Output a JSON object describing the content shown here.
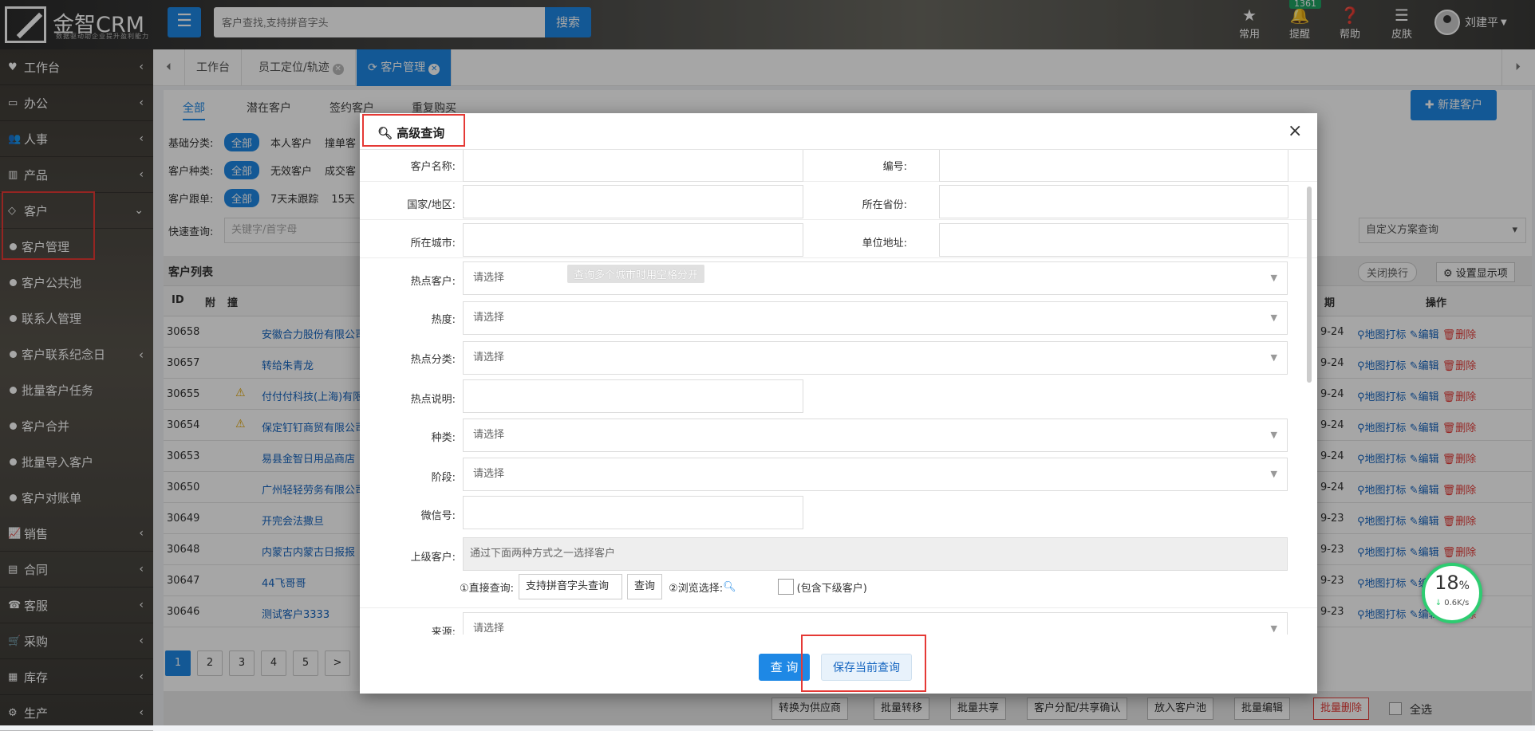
{
  "header": {
    "app_name": "金智CRM",
    "slogan": "数据驱动助企业提升盈利能力",
    "search_placeholder": "客户查找,支持拼音字头",
    "search_button": "搜索",
    "tools": [
      {
        "label": "常用",
        "icon": "star-icon"
      },
      {
        "label": "提醒",
        "icon": "bell-icon",
        "badge": "1361"
      },
      {
        "label": "帮助",
        "icon": "help-icon"
      },
      {
        "label": "皮肤",
        "icon": "skin-icon"
      }
    ],
    "user_name": "刘建平"
  },
  "sidebar": {
    "items": [
      {
        "label": "工作台",
        "icon": "heart-icon"
      },
      {
        "label": "办公",
        "icon": "monitor-icon"
      },
      {
        "label": "人事",
        "icon": "users-icon"
      },
      {
        "label": "产品",
        "icon": "book-icon"
      },
      {
        "label": "客户",
        "icon": "diamond-icon"
      }
    ],
    "subitems": [
      "客户管理",
      "客户公共池",
      "联系人管理",
      "客户联系纪念日",
      "批量客户任务",
      "客户合并",
      "批量导入客户",
      "客户对账单"
    ],
    "items_after": [
      {
        "label": "销售",
        "icon": "chart-icon"
      },
      {
        "label": "合同",
        "icon": "contract-icon"
      },
      {
        "label": "客服",
        "icon": "phone-icon"
      },
      {
        "label": "采购",
        "icon": "cart-icon"
      },
      {
        "label": "库存",
        "icon": "cubes-icon"
      },
      {
        "label": "生产",
        "icon": "cogs-icon"
      }
    ]
  },
  "tabs": [
    "工作台",
    "员工定位/轨迹",
    "客户管理"
  ],
  "content": {
    "subtabs": [
      "全部",
      "潜在客户",
      "签约客户",
      "重复购买"
    ],
    "new_button": "新建客户",
    "filters": {
      "basic_label": "基础分类:",
      "basic_opts": [
        "全部",
        "本人客户",
        "撞单客"
      ],
      "type_label": "客户种类:",
      "type_opts": [
        "全部",
        "无效客户",
        "成交客"
      ],
      "follow_label": "客户跟单:",
      "follow_opts": [
        "全部",
        "7天未跟踪",
        "15天"
      ],
      "quick_label": "快速查询:",
      "quick_placeholder": "关键字/首字母"
    },
    "scheme_select": "自定义方案查询",
    "list_title": "客户列表",
    "wrap_toggle": "关闭换行",
    "display_setting": "设置显示项",
    "columns": [
      "ID",
      "附",
      "撞",
      "期",
      "操作"
    ],
    "rows": [
      {
        "id": "30658",
        "name": "安徽合力股份有限公司",
        "warn": false,
        "date": "9-24"
      },
      {
        "id": "30657",
        "name": "转给朱青龙",
        "warn": false,
        "date": "9-24"
      },
      {
        "id": "30655",
        "name": "付付付科技(上海)有限",
        "warn": true,
        "date": "9-24"
      },
      {
        "id": "30654",
        "name": "保定钉钉商贸有限公司",
        "warn": true,
        "date": "9-24"
      },
      {
        "id": "30653",
        "name": "易县金智日用品商店",
        "warn": false,
        "date": "9-24"
      },
      {
        "id": "30650",
        "name": "广州轻轻劳务有限公司",
        "warn": false,
        "date": "9-24"
      },
      {
        "id": "30649",
        "name": "开完会法撒旦",
        "warn": false,
        "date": "9-23"
      },
      {
        "id": "30648",
        "name": "内蒙古内蒙古日报报",
        "warn": false,
        "date": "9-23"
      },
      {
        "id": "30647",
        "name": "44飞哥哥",
        "warn": false,
        "date": "9-23"
      },
      {
        "id": "30646",
        "name": "测试客户3333",
        "warn": false,
        "date": "9-23"
      }
    ],
    "row_ops": {
      "map": "地图打标",
      "edit": "编辑",
      "delete": "删除"
    },
    "pages": [
      "1",
      "2",
      "3",
      "4",
      "5",
      ">"
    ],
    "bottom_buttons": [
      "转换为供应商",
      "批量转移",
      "批量共享",
      "客户分配/共享确认",
      "放入客户池",
      "批量编辑",
      "批量删除",
      "全选"
    ]
  },
  "modal": {
    "title": "高级查询",
    "close": "×",
    "fields": {
      "name": "客户名称:",
      "code": "编号:",
      "country": "国家/地区:",
      "province": "所在省份:",
      "city": "所在城市:",
      "address": "单位地址:",
      "hot": "热点客户:",
      "heat": "热度:",
      "hot_cat": "热点分类:",
      "hot_desc": "热点说明:",
      "kind": "种类:",
      "stage": "阶段:",
      "wechat": "微信号:",
      "parent": "上级客户:",
      "source": "来源:"
    },
    "select_placeholder": "请选择",
    "city_tip": "查询多个城市时用空格分开",
    "parent_hint": "通过下面两种方式之一选择客户",
    "direct_label": "①直接查询:",
    "direct_placeholder": "支持拼音字头查询",
    "direct_button": "查询",
    "browse_label": "②浏览选择:",
    "include_sub": "(包含下级客户)",
    "query_button": "查 询",
    "save_button": "保存当前查询"
  },
  "speed": {
    "percent": "18",
    "unit": "%",
    "rate": "0.6K/s"
  },
  "colors": {
    "accent": "#1e88e5",
    "highlight": "#e53935",
    "danger": "#e53935"
  }
}
